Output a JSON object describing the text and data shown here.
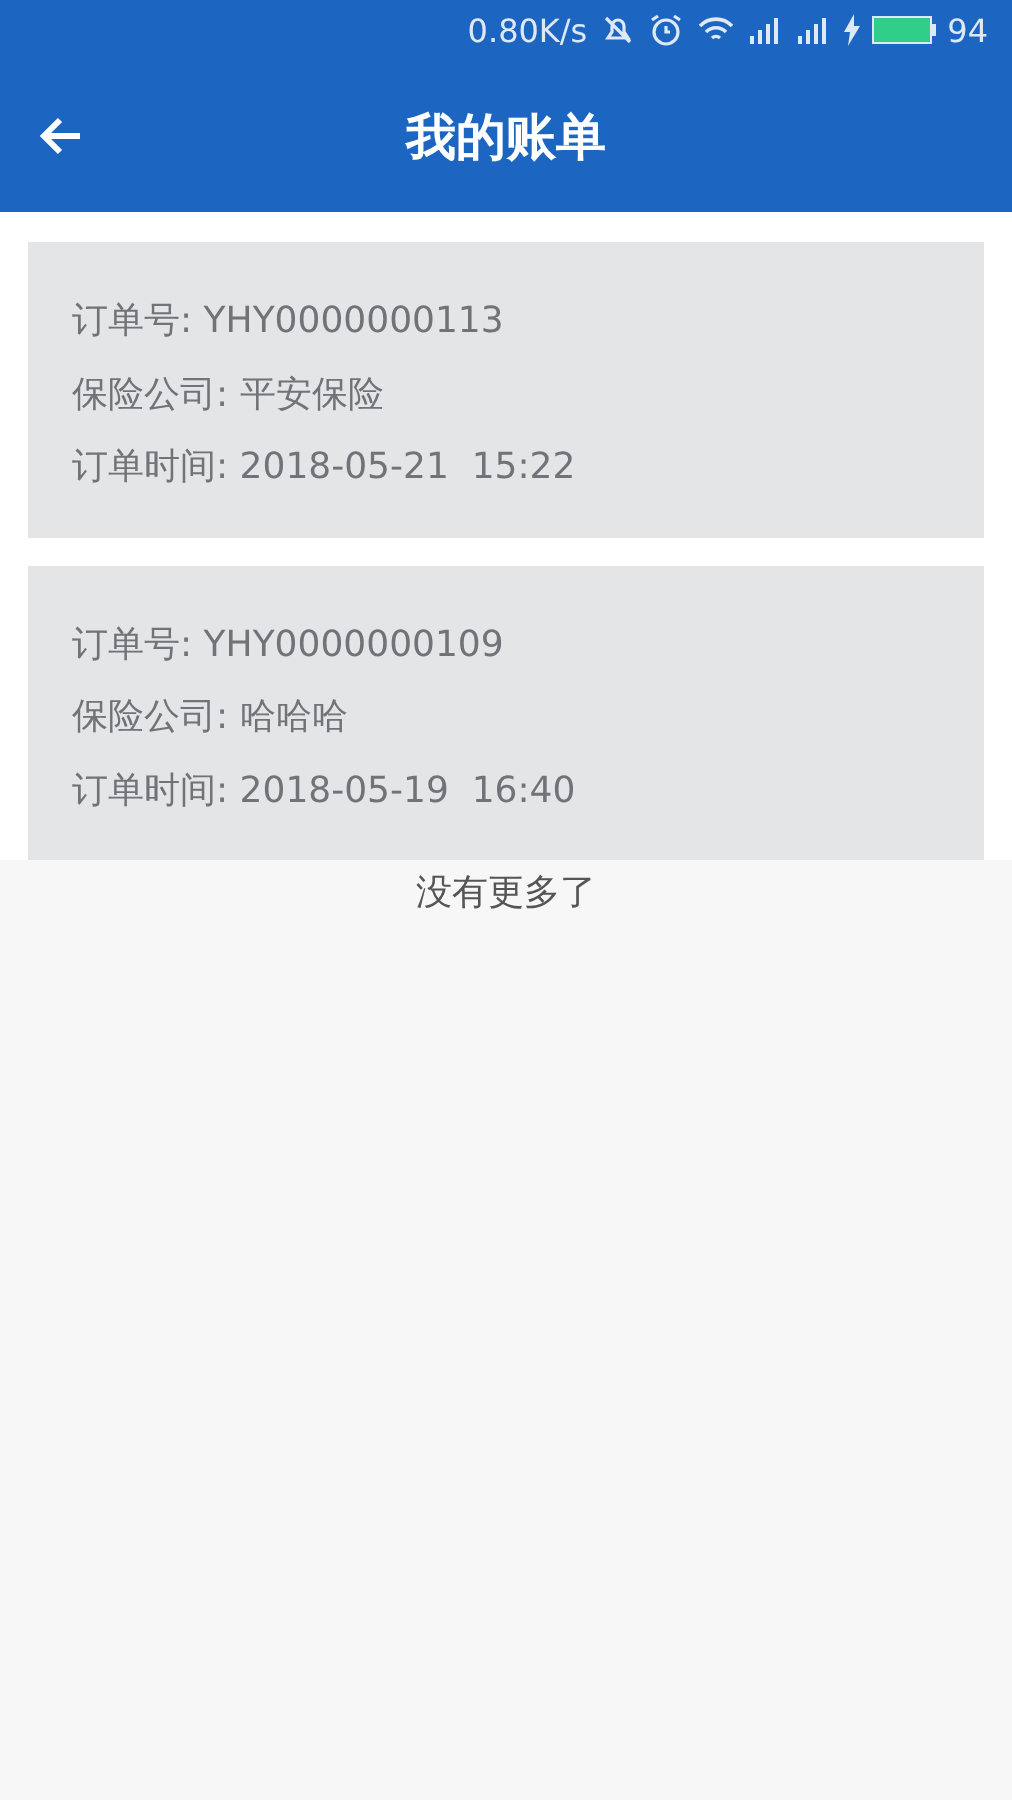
{
  "status_bar": {
    "speed": "0.80K/s",
    "battery": "94"
  },
  "header": {
    "title": "我的账单"
  },
  "orders": [
    {
      "lines": [
        "订单号: YHY0000000113",
        "保险公司: 平安保险",
        "订单时间: 2018-05-21  15:22"
      ]
    },
    {
      "lines": [
        "订单号: YHY0000000109",
        "保险公司: 哈哈哈",
        "订单时间: 2018-05-19  16:40"
      ]
    }
  ],
  "footer": "没有更多了"
}
